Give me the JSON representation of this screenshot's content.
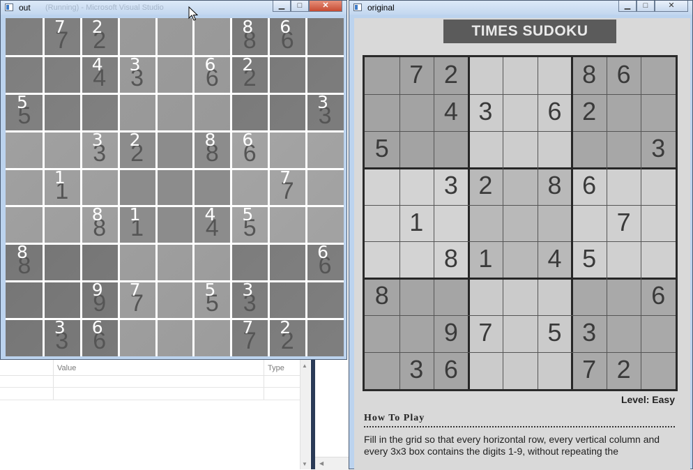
{
  "out_window": {
    "title": "out",
    "ghost_title": "(Running) - Microsoft Visual Studio",
    "controls": {
      "minimize": "▁",
      "maximize": "□",
      "close": "✕"
    },
    "recognized_grid": [
      [
        "",
        "7",
        "2",
        "",
        "",
        "",
        "8",
        "6",
        ""
      ],
      [
        "",
        "",
        "4",
        "3",
        "",
        "6",
        "2",
        "",
        ""
      ],
      [
        "5",
        "",
        "",
        "",
        "",
        "",
        "",
        "",
        "3"
      ],
      [
        "",
        "",
        "3",
        "2",
        "",
        "8",
        "6",
        "",
        ""
      ],
      [
        "",
        "1",
        "",
        "",
        "",
        "",
        "",
        "7",
        ""
      ],
      [
        "",
        "",
        "8",
        "1",
        "",
        "4",
        "5",
        "",
        ""
      ],
      [
        "8",
        "",
        "",
        "",
        "",
        "",
        "",
        "",
        "6"
      ],
      [
        "",
        "",
        "9",
        "7",
        "",
        "5",
        "3",
        "",
        ""
      ],
      [
        "",
        "3",
        "6",
        "",
        "",
        "",
        "7",
        "2",
        ""
      ]
    ]
  },
  "original_window": {
    "title": "original",
    "controls": {
      "minimize": "▁",
      "maximize": "□",
      "close": "✕"
    },
    "header": "TIMES SUDOKU",
    "puzzle_grid": [
      [
        "",
        "7",
        "2",
        "",
        "",
        "",
        "8",
        "6",
        ""
      ],
      [
        "",
        "",
        "4",
        "3",
        "",
        "6",
        "2",
        "",
        ""
      ],
      [
        "5",
        "",
        "",
        "",
        "",
        "",
        "",
        "",
        "3"
      ],
      [
        "",
        "",
        "3",
        "2",
        "",
        "8",
        "6",
        "",
        ""
      ],
      [
        "",
        "1",
        "",
        "",
        "",
        "",
        "",
        "7",
        ""
      ],
      [
        "",
        "",
        "8",
        "1",
        "",
        "4",
        "5",
        "",
        ""
      ],
      [
        "8",
        "",
        "",
        "",
        "",
        "",
        "",
        "",
        "6"
      ],
      [
        "",
        "",
        "9",
        "7",
        "",
        "5",
        "3",
        "",
        ""
      ],
      [
        "",
        "3",
        "6",
        "",
        "",
        "",
        "7",
        "2",
        ""
      ]
    ],
    "level": "Level: Easy",
    "how_to_play_title": "How To Play",
    "how_to_play_text": "Fill in the grid so that every horizontal row, every vertical column and every 3x3 box contains the digits 1-9, without repeating the"
  },
  "locals_panel": {
    "columns": [
      "Value",
      "Type"
    ]
  }
}
